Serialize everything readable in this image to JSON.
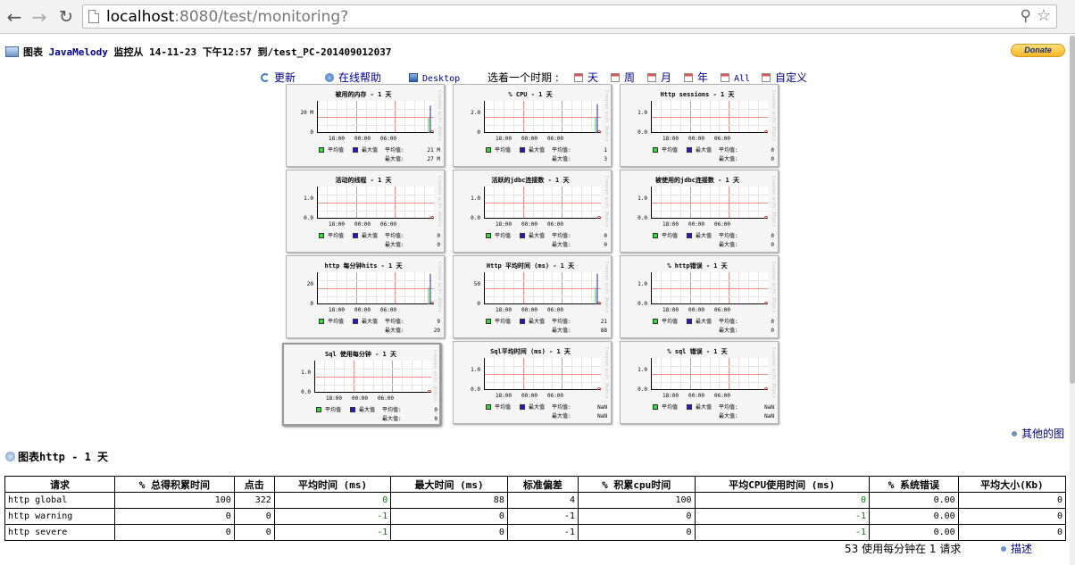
{
  "browser": {
    "url_host": "localhost",
    "url_rest": ":8080/test/monitoring?"
  },
  "header": {
    "label_graphs": "图表",
    "app_name": "JavaMelody",
    "label_monitoring_from": "监控从",
    "date": "14-11-23",
    "time": "下午12:57",
    "label_to": "到",
    "target": "/test_PC-201409012037",
    "donate_label": "Donate"
  },
  "toolbar": {
    "refresh": "更新",
    "help": "在线帮助",
    "desktop": "Desktop",
    "choose_period": "选着一个时期 :",
    "day": "天",
    "week": "周",
    "month": "月",
    "year": "年",
    "all": "All",
    "custom": "自定义"
  },
  "legend": {
    "avg_label": "平均值",
    "max_label": "最大值",
    "avg_value_label": "平均值:",
    "max_value_label": "最大值:"
  },
  "side_text": "Created with JRobin",
  "graphs": [
    {
      "title": "被用的内存 - 1 天",
      "y_max_label": "20 M",
      "y_min_label": "0",
      "x_labels": [
        "18:00",
        "00:00",
        "06:00"
      ],
      "avg": "21 M",
      "max": "27 M",
      "spike": 0.85
    },
    {
      "title": "% CPU - 1 天",
      "y_max_label": "2.0",
      "y_min_label": "0",
      "x_labels": [
        "18:00",
        "00:00",
        "06:00"
      ],
      "avg": "1",
      "max": "3",
      "spike": 0.9
    },
    {
      "title": "Http sessions - 1 天",
      "y_max_label": "1.0",
      "y_min_label": "0.0",
      "x_labels": [
        "18:00",
        "00:00",
        "06:00"
      ],
      "avg": "0",
      "max": "0",
      "spike": 0
    },
    {
      "title": "活动的线程 - 1 天",
      "y_max_label": "1.0",
      "y_min_label": "0.0",
      "x_labels": [
        "18:00",
        "00:00",
        "06:00"
      ],
      "avg": "0",
      "max": "0",
      "spike": 0
    },
    {
      "title": "活跃的jdbc连接数 - 1 天",
      "y_max_label": "1.0",
      "y_min_label": "0.0",
      "x_labels": [
        "18:00",
        "00:00",
        "06:00"
      ],
      "avg": "0",
      "max": "0",
      "spike": 0
    },
    {
      "title": "被使用的jdbc连接数 - 1 天",
      "y_max_label": "1.0",
      "y_min_label": "0.0",
      "x_labels": [
        "18:00",
        "00:00",
        "06:00"
      ],
      "avg": "0",
      "max": "0",
      "spike": 0
    },
    {
      "title": "http 每分钟hits - 1 天",
      "y_max_label": "20",
      "y_min_label": "0",
      "x_labels": [
        "18:00",
        "00:00",
        "06:00"
      ],
      "avg": "9",
      "max": "29",
      "spike": 0.95
    },
    {
      "title": "Http 平均时间 (ms) - 1 天",
      "y_max_label": "50",
      "y_min_label": "0",
      "x_labels": [
        "18:00",
        "00:00",
        "06:00"
      ],
      "avg": "21",
      "max": "88",
      "spike": 0.95
    },
    {
      "title": "% http错误 - 1 天",
      "y_max_label": "1.0",
      "y_min_label": "0.0",
      "x_labels": [
        "18:00",
        "00:00",
        "06:00"
      ],
      "avg": "0",
      "max": "0",
      "spike": 0
    },
    {
      "title": "Sql 使用每分钟 - 1 天",
      "y_max_label": "1.0",
      "y_min_label": "0.0",
      "x_labels": [
        "18:00",
        "00:00",
        "06:00"
      ],
      "avg": "0",
      "max": "0",
      "spike": 0
    },
    {
      "title": "Sql平均时间 (ms) - 1 天",
      "y_max_label": "1.0",
      "y_min_label": "0.0",
      "x_labels": [
        "18:00",
        "00:00",
        "06:00"
      ],
      "avg": "NaN",
      "max": "NaN",
      "spike": 0
    },
    {
      "title": "% sql 错误 - 1 天",
      "y_max_label": "1.0",
      "y_min_label": "0.0",
      "x_labels": [
        "18:00",
        "00:00",
        "06:00"
      ],
      "avg": "NaN",
      "max": "NaN",
      "spike": 0
    }
  ],
  "more_graphs": "其他的图",
  "section_title": "图表http - 1 天",
  "table": {
    "headers": [
      "请求",
      "% 总得积累时间",
      "点击",
      "平均时间 (ms)",
      "最大时间 (ms)",
      "标准偏差",
      "% 积累cpu时间",
      "平均CPU使用时间 (ms)",
      "% 系统错误",
      "平均大小(Kb)"
    ],
    "rows": [
      [
        "http global",
        "100",
        "322",
        "0",
        "88",
        "4",
        "100",
        "0",
        "0.00",
        "0"
      ],
      [
        "http warning",
        "0",
        "0",
        "-1",
        "0",
        "-1",
        "0",
        "-1",
        "0.00",
        "0"
      ],
      [
        "http severe",
        "0",
        "0",
        "-1",
        "0",
        "-1",
        "0",
        "-1",
        "0.00",
        "0"
      ]
    ]
  },
  "footer": {
    "note": "53 使用每分钟在 1 请求",
    "describe": "描述"
  },
  "colors": {
    "link": "#00008b",
    "avg_series": "#2edc2e",
    "max_series": "#1c1cc8",
    "grid_line": "#f08c8c"
  }
}
